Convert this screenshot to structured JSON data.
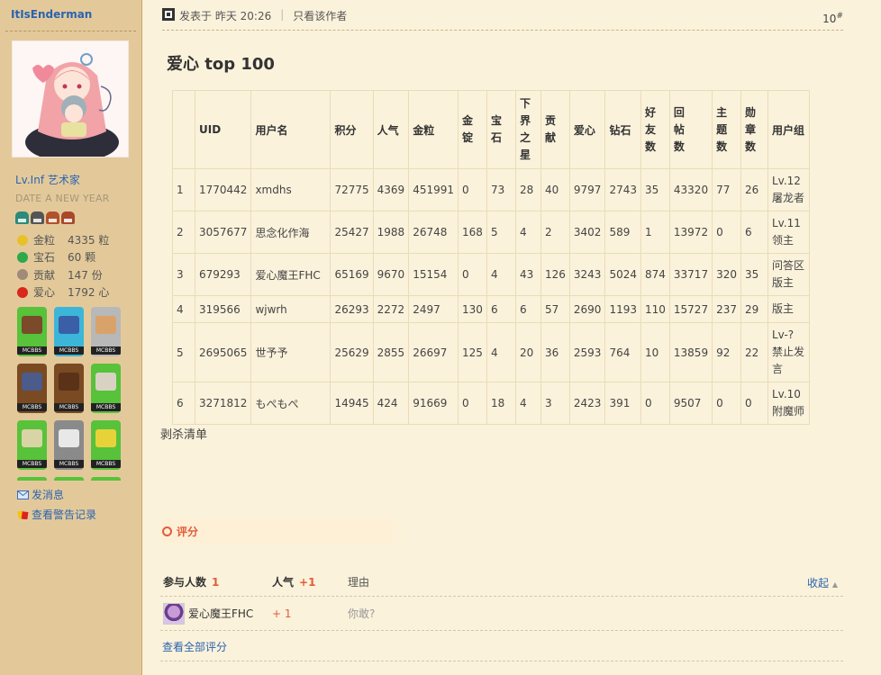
{
  "sidebar": {
    "username": "ItIsEnderman",
    "level": "Lv.Inf 艺术家",
    "motto": "DATE A NEW YEAR",
    "helmet_colors": [
      "#2c8a7a",
      "#555555",
      "#b0522c",
      "#a9482a"
    ],
    "stats": [
      {
        "label": "金粒",
        "value": "4335 粒",
        "icon": "gold-nugget-icon",
        "color": "#e8c02a"
      },
      {
        "label": "宝石",
        "value": "60 颗",
        "icon": "emerald-icon",
        "color": "#2fa84a"
      },
      {
        "label": "贡献",
        "value": "147 份",
        "icon": "contribution-icon",
        "color": "#a08a78"
      },
      {
        "label": "爱心",
        "value": "1792 心",
        "icon": "apple-heart-icon",
        "color": "#d9271c"
      }
    ],
    "medal_tag": "MCBBS",
    "medals": [
      {
        "name": "medal-book",
        "bg": "#57c23a",
        "pic": "#7a4a2a"
      },
      {
        "name": "medal-blue-figure",
        "bg": "#3cb6d8",
        "pic": "#3a5fa8"
      },
      {
        "name": "medal-cake",
        "bg": "#b8b8b8",
        "pic": "#d9a26a"
      },
      {
        "name": "medal-painting",
        "bg": "#7a4a22",
        "pic": "#4b5b8a"
      },
      {
        "name": "medal-leather-tunic",
        "bg": "#7a4a22",
        "pic": "#5a3218"
      },
      {
        "name": "medal-map-book",
        "bg": "#57c23a",
        "pic": "#d9d2c2"
      },
      {
        "name": "medal-map",
        "bg": "#57c23a",
        "pic": "#d8d4a6"
      },
      {
        "name": "medal-feather",
        "bg": "#8a8a8a",
        "pic": "#e8e8e8"
      },
      {
        "name": "medal-gold-block",
        "bg": "#57c23a",
        "pic": "#e8d23a"
      }
    ],
    "links": [
      {
        "label": "发消息",
        "icon": "envelope-icon"
      },
      {
        "label": "查看警告记录",
        "icon": "warning-card-icon"
      }
    ]
  },
  "post": {
    "posted_label": "发表于 昨天 20:26",
    "only_author": "只看该作者",
    "floor_number": "10",
    "floor_sup": "#",
    "title": "爱心 top 100",
    "table_headers": [
      "",
      "UID",
      "用户名",
      "积分",
      "人气",
      "金粒",
      "金锭",
      "宝石",
      "下界之星",
      "贡献",
      "爱心",
      "钻石",
      "好友数",
      "回帖数",
      "主题数",
      "勋章数",
      "用户组"
    ],
    "table_rows": [
      [
        "1",
        "1770442",
        "xmdhs",
        "72775",
        "4369",
        "451991",
        "0",
        "73",
        "28",
        "40",
        "9797",
        "2743",
        "35",
        "43320",
        "77",
        "26",
        "Lv.12 屠龙者"
      ],
      [
        "2",
        "3057677",
        "思念化作海",
        "25427",
        "1988",
        "26748",
        "168",
        "5",
        "4",
        "2",
        "3402",
        "589",
        "1",
        "13972",
        "0",
        "6",
        "Lv.11 领主"
      ],
      [
        "3",
        "679293",
        "爱心魔王FHC",
        "65169",
        "9670",
        "15154",
        "0",
        "4",
        "43",
        "126",
        "3243",
        "5024",
        "874",
        "33717",
        "320",
        "35",
        "问答区版主"
      ],
      [
        "4",
        "319566",
        "wjwrh",
        "26293",
        "2272",
        "2497",
        "130",
        "6",
        "6",
        "57",
        "2690",
        "1193",
        "110",
        "15727",
        "237",
        "29",
        "版主"
      ],
      [
        "5",
        "2695065",
        "世予予",
        "25629",
        "2855",
        "26697",
        "125",
        "4",
        "20",
        "36",
        "2593",
        "764",
        "10",
        "13859",
        "92",
        "22",
        "Lv-? 禁止发言"
      ],
      [
        "6",
        "3271812",
        "もぺもぺ",
        "14945",
        "424",
        "91669",
        "0",
        "18",
        "4",
        "3",
        "2423",
        "391",
        "0",
        "9507",
        "0",
        "0",
        "Lv.10 附魔师"
      ]
    ],
    "kill_list": "剥杀清单"
  },
  "rating": {
    "title": "评分",
    "participants_label": "参与人数",
    "participants_count": "1",
    "popularity_label": "人气",
    "popularity_total": "+1",
    "reason_label": "理由",
    "collapse_label": "收起",
    "entries": [
      {
        "user": "爱心魔王FHC",
        "popularity": "+ 1",
        "reason": "你敢?"
      }
    ],
    "view_all": "查看全部评分"
  }
}
